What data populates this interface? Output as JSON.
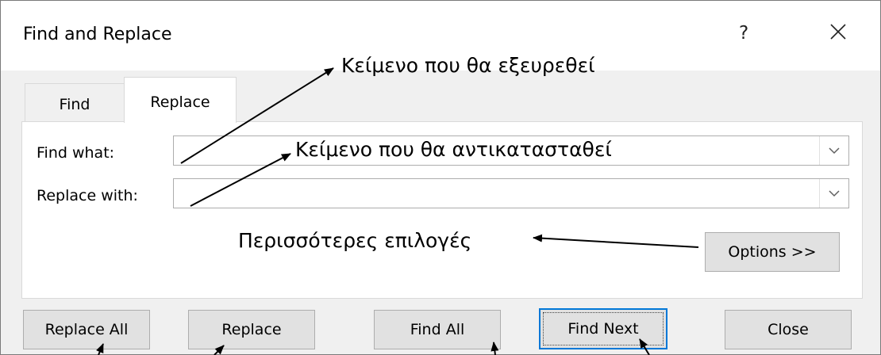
{
  "window": {
    "title": "Find and Replace",
    "help_label": "?"
  },
  "tabs": [
    {
      "label": "Find",
      "active": false
    },
    {
      "label": "Replace",
      "active": true
    }
  ],
  "form": {
    "find_label": "Find what:",
    "find_value": "",
    "replace_label": "Replace with:",
    "replace_value": ""
  },
  "buttons": {
    "options": "Options >>",
    "replace_all": "Replace All",
    "replace": "Replace",
    "find_all": "Find All",
    "find_next": "Find Next",
    "close": "Close"
  },
  "annotations": {
    "find_text": "Κείμενο που θα εξευρεθεί",
    "replace_text": "Κείμενο που θα αντικατασταθεί",
    "more_options": "Περισσότερες επιλογές"
  },
  "colors": {
    "default_button_border": "#0078d7",
    "button_face": "#e1e1e1",
    "dialog_bg": "#f0f0f0"
  },
  "icons": [
    "close-icon",
    "chevron-down-icon",
    "help-icon"
  ]
}
